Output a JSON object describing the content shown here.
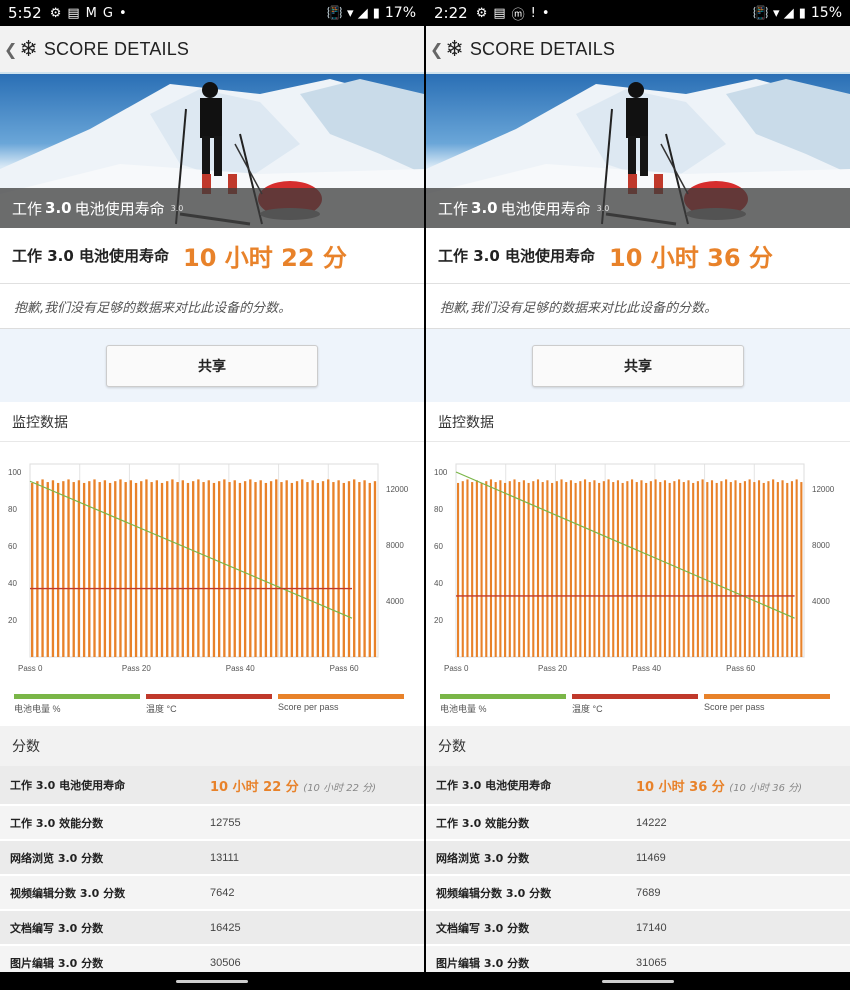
{
  "panels": [
    {
      "status": {
        "time": "5:52",
        "left_icons": [
          "⚙",
          "▤",
          "M",
          "G",
          "•"
        ],
        "right_icons": "📳 ▾ ◢",
        "battery": "17%"
      },
      "app_title": "SCORE DETAILS",
      "hero_caption_pre": "工作",
      "hero_caption_bold": "3.0",
      "hero_caption_post": "电池使用寿命",
      "hero_caption_ver": "3.0",
      "score_label": "工作 3.0 电池使用寿命",
      "score_value": "10 小时 22 分",
      "note": "抱歉,我们没有足够的数据来对比此设备的分数。",
      "share_label": "共享",
      "monitor_heading": "监控数据",
      "scores_heading": "分数",
      "chart_data": {
        "type": "bar",
        "x_ticks": [
          "Pass 0",
          "Pass 20",
          "Pass 40",
          "Pass 60"
        ],
        "y_left_ticks": [
          "100",
          "80",
          "60",
          "40",
          "20"
        ],
        "y_right_ticks": [
          "12000",
          "8000",
          "4000"
        ],
        "series": [
          {
            "name": "电池电量 %",
            "color": "#7ab648",
            "start": 95,
            "end": 21,
            "passes": 62
          },
          {
            "name": "温度 °C",
            "color": "#c0392b",
            "level": 37
          },
          {
            "name": "Score per pass",
            "color": "#e8822a",
            "bars": 67,
            "height_pct": 96
          }
        ]
      },
      "rows": [
        {
          "label": "工作 3.0 电池使用寿命",
          "value": "10 小时 22 分",
          "paren": "(10 小时 22 分)"
        },
        {
          "label": "工作 3.0 效能分数",
          "value": "12755"
        },
        {
          "label": "网络浏览 3.0 分数",
          "value": "13111"
        },
        {
          "label": "视频编辑分数 3.0 分数",
          "value": "7642"
        },
        {
          "label": "文档编写 3.0 分数",
          "value": "16425"
        },
        {
          "label": "图片编辑 3.0 分数",
          "value": "30506"
        }
      ]
    },
    {
      "status": {
        "time": "2:22",
        "left_icons": [
          "⚙",
          "▤",
          "ⓜ",
          "!",
          "•"
        ],
        "right_icons": "📳 ▾ ◢",
        "battery": "15%"
      },
      "app_title": "SCORE DETAILS",
      "hero_caption_pre": "工作",
      "hero_caption_bold": "3.0",
      "hero_caption_post": "电池使用寿命",
      "hero_caption_ver": "3.0",
      "score_label": "工作 3.0 电池使用寿命",
      "score_value": "10 小时 36 分",
      "note": "抱歉,我们没有足够的数据来对比此设备的分数。",
      "share_label": "共享",
      "monitor_heading": "监控数据",
      "scores_heading": "分数",
      "chart_data": {
        "type": "bar",
        "x_ticks": [
          "Pass 0",
          "Pass 20",
          "Pass 40",
          "Pass 60"
        ],
        "y_left_ticks": [
          "100",
          "80",
          "60",
          "40",
          "20"
        ],
        "y_right_ticks": [
          "12000",
          "8000",
          "4000"
        ],
        "series": [
          {
            "name": "电池电量 %",
            "color": "#7ab648",
            "start": 100,
            "end": 21,
            "passes": 72
          },
          {
            "name": "温度 °C",
            "color": "#c0392b",
            "level": 33
          },
          {
            "name": "Score per pass",
            "color": "#e8822a",
            "bars": 74,
            "height_pct": 96
          }
        ]
      },
      "rows": [
        {
          "label": "工作 3.0 电池使用寿命",
          "value": "10 小时 36 分",
          "paren": "(10 小时 36 分)"
        },
        {
          "label": "工作 3.0 效能分数",
          "value": "14222"
        },
        {
          "label": "网络浏览 3.0 分数",
          "value": "11469"
        },
        {
          "label": "视频编辑分数 3.0 分数",
          "value": "7689"
        },
        {
          "label": "文档编写 3.0 分数",
          "value": "17140"
        },
        {
          "label": "图片编辑 3.0 分数",
          "value": "31065"
        }
      ]
    }
  ]
}
